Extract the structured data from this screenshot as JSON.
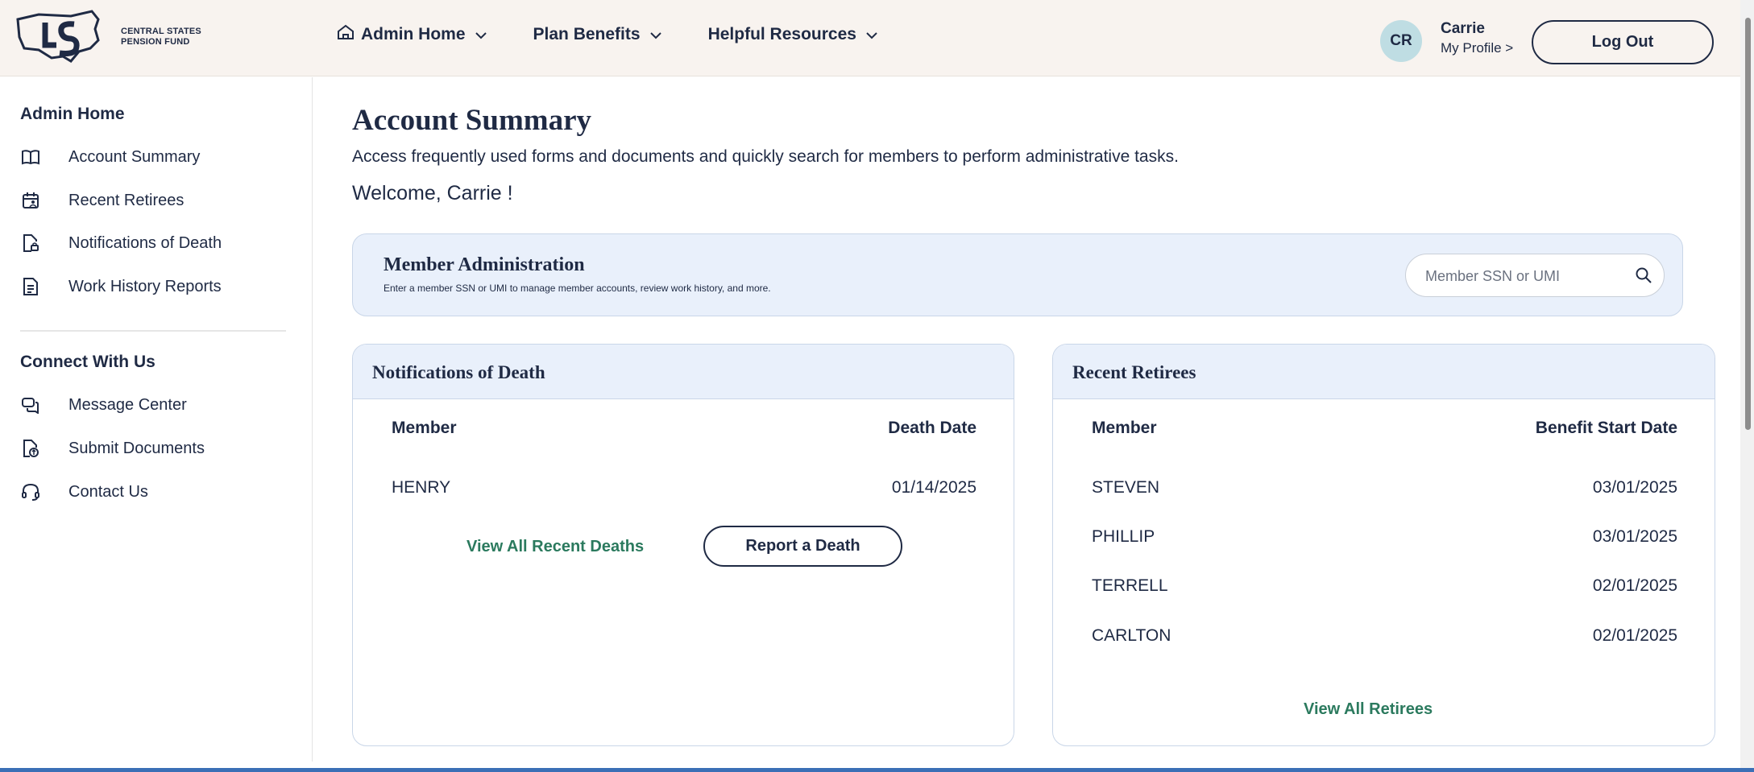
{
  "header": {
    "logo_text_line1": "CENTRAL STATES",
    "logo_text_line2": "PENSION FUND",
    "nav": [
      {
        "label": "Admin Home",
        "icon": "home-icon"
      },
      {
        "label": "Plan Benefits"
      },
      {
        "label": "Helpful Resources"
      }
    ],
    "user": {
      "initials": "CR",
      "name": "Carrie",
      "profile_link": "My Profile >"
    },
    "logout_label": "Log Out"
  },
  "sidebar": {
    "section1_title": "Admin Home",
    "section1_items": [
      {
        "label": "Account Summary",
        "icon": "book-icon"
      },
      {
        "label": "Recent Retirees",
        "icon": "calendar-person-icon"
      },
      {
        "label": "Notifications of Death",
        "icon": "document-lock-icon"
      },
      {
        "label": "Work History Reports",
        "icon": "document-lines-icon"
      }
    ],
    "section2_title": "Connect With Us",
    "section2_items": [
      {
        "label": "Message Center",
        "icon": "chat-bubbles-icon"
      },
      {
        "label": "Submit Documents",
        "icon": "document-upload-icon"
      },
      {
        "label": "Contact Us",
        "icon": "headset-icon"
      }
    ]
  },
  "main": {
    "title": "Account Summary",
    "description": "Access frequently used forms and documents and quickly search for members to perform administrative tasks.",
    "welcome": "Welcome, Carrie !",
    "member_admin": {
      "title": "Member Administration",
      "subtitle": "Enter a member SSN or UMI to manage member accounts, review work history, and more.",
      "search_placeholder": "Member SSN or UMI"
    },
    "deaths": {
      "title": "Notifications of Death",
      "col_member": "Member",
      "col_date": "Death Date",
      "rows": [
        {
          "member": "HENRY",
          "date": "01/14/2025"
        }
      ],
      "view_all_label": "View All Recent Deaths",
      "report_label": "Report a Death"
    },
    "retirees": {
      "title": "Recent Retirees",
      "col_member": "Member",
      "col_date": "Benefit Start Date",
      "rows": [
        {
          "member": "STEVEN",
          "date": "03/01/2025"
        },
        {
          "member": "PHILLIP",
          "date": "03/01/2025"
        },
        {
          "member": "TERRELL",
          "date": "02/01/2025"
        },
        {
          "member": "CARLTON",
          "date": "02/01/2025"
        }
      ],
      "view_all_label": "View All Retirees"
    }
  },
  "colors": {
    "navy": "#1f2a44",
    "header_bg": "#f8f3ef",
    "card_head_bg": "#e9f0fb",
    "link_green": "#2b7a5e",
    "avatar_bg": "#bfdde3"
  }
}
